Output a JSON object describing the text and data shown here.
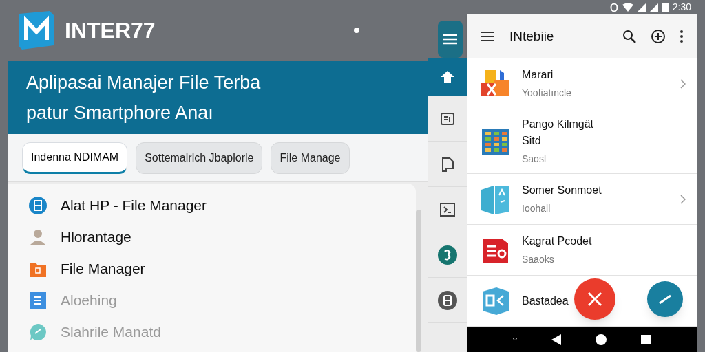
{
  "brand": {
    "title": "INTER77"
  },
  "banner": {
    "lines": [
      "Aplipasai Manajer File Terba",
      "patur Smartphore Anaı"
    ]
  },
  "tabs": [
    {
      "label": "Indenna NDIMAM",
      "selected": true
    },
    {
      "label": "Sottemalrlch Jbaplorle",
      "selected": false
    },
    {
      "label": "File Manage",
      "selected": false
    }
  ],
  "menu": [
    {
      "kind": "storage",
      "label": "Alat HP - File Manager",
      "faded": false
    },
    {
      "kind": "person",
      "label": "Hlorantage",
      "faded": false
    },
    {
      "kind": "folder",
      "label": "File Manager",
      "faded": false
    },
    {
      "kind": "doc",
      "label": "Aloehing",
      "faded": true
    },
    {
      "kind": "chat",
      "label": "Slahrile Manatd",
      "faded": true
    }
  ],
  "rail": [
    {
      "kind": "home",
      "selected": true
    },
    {
      "kind": "list",
      "selected": false
    },
    {
      "kind": "doc",
      "selected": false
    },
    {
      "kind": "terminal",
      "selected": false
    },
    {
      "kind": "badge",
      "selected": false
    },
    {
      "kind": "device",
      "selected": false
    }
  ],
  "phone": {
    "time": "2:30",
    "title": "INtebiie",
    "rows": [
      {
        "kind": "multi",
        "title": "Marari",
        "subtitle": "Yoofiatıncle",
        "chevron": true
      },
      {
        "kind": "grid",
        "title": "Pango Kilmgät Sitd",
        "subtitle": "Saosl",
        "chevron": false
      },
      {
        "kind": "split",
        "title": "Somer Sonmoet",
        "subtitle": "Ioohall",
        "chevron": true
      },
      {
        "kind": "red",
        "title": "Kagrat Pcodet",
        "subtitle": "Saaoks",
        "chevron": false
      },
      {
        "kind": "blue",
        "title": "Bastadea",
        "chevron": false
      }
    ]
  }
}
